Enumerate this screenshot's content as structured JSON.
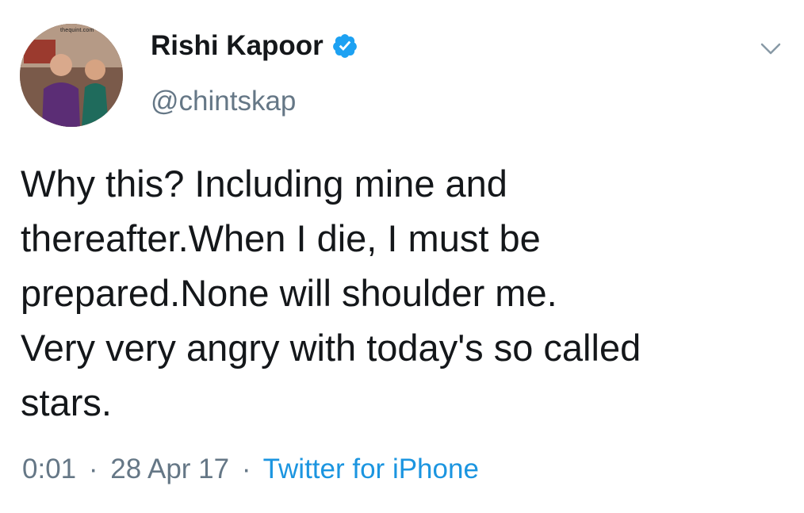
{
  "tweet": {
    "author": {
      "name": "Rishi Kapoor",
      "handle": "@chintskap",
      "verified": true,
      "avatar_watermark": "thequint.com"
    },
    "text_lines": [
      "Why this? Including mine and",
      "thereafter.When I die, I must be",
      "prepared.None will shoulder me.",
      "Very very angry with today's so called",
      "stars."
    ],
    "time": "0:01",
    "separator": "·",
    "date": "28 Apr 17",
    "source": "Twitter for iPhone"
  },
  "colors": {
    "name": "#14171a",
    "secondary": "#657786",
    "link": "#1b95e0",
    "verified_badge": "#1da1f2"
  },
  "icons": {
    "verified": "verified-badge-icon",
    "menu": "chevron-down-icon"
  }
}
